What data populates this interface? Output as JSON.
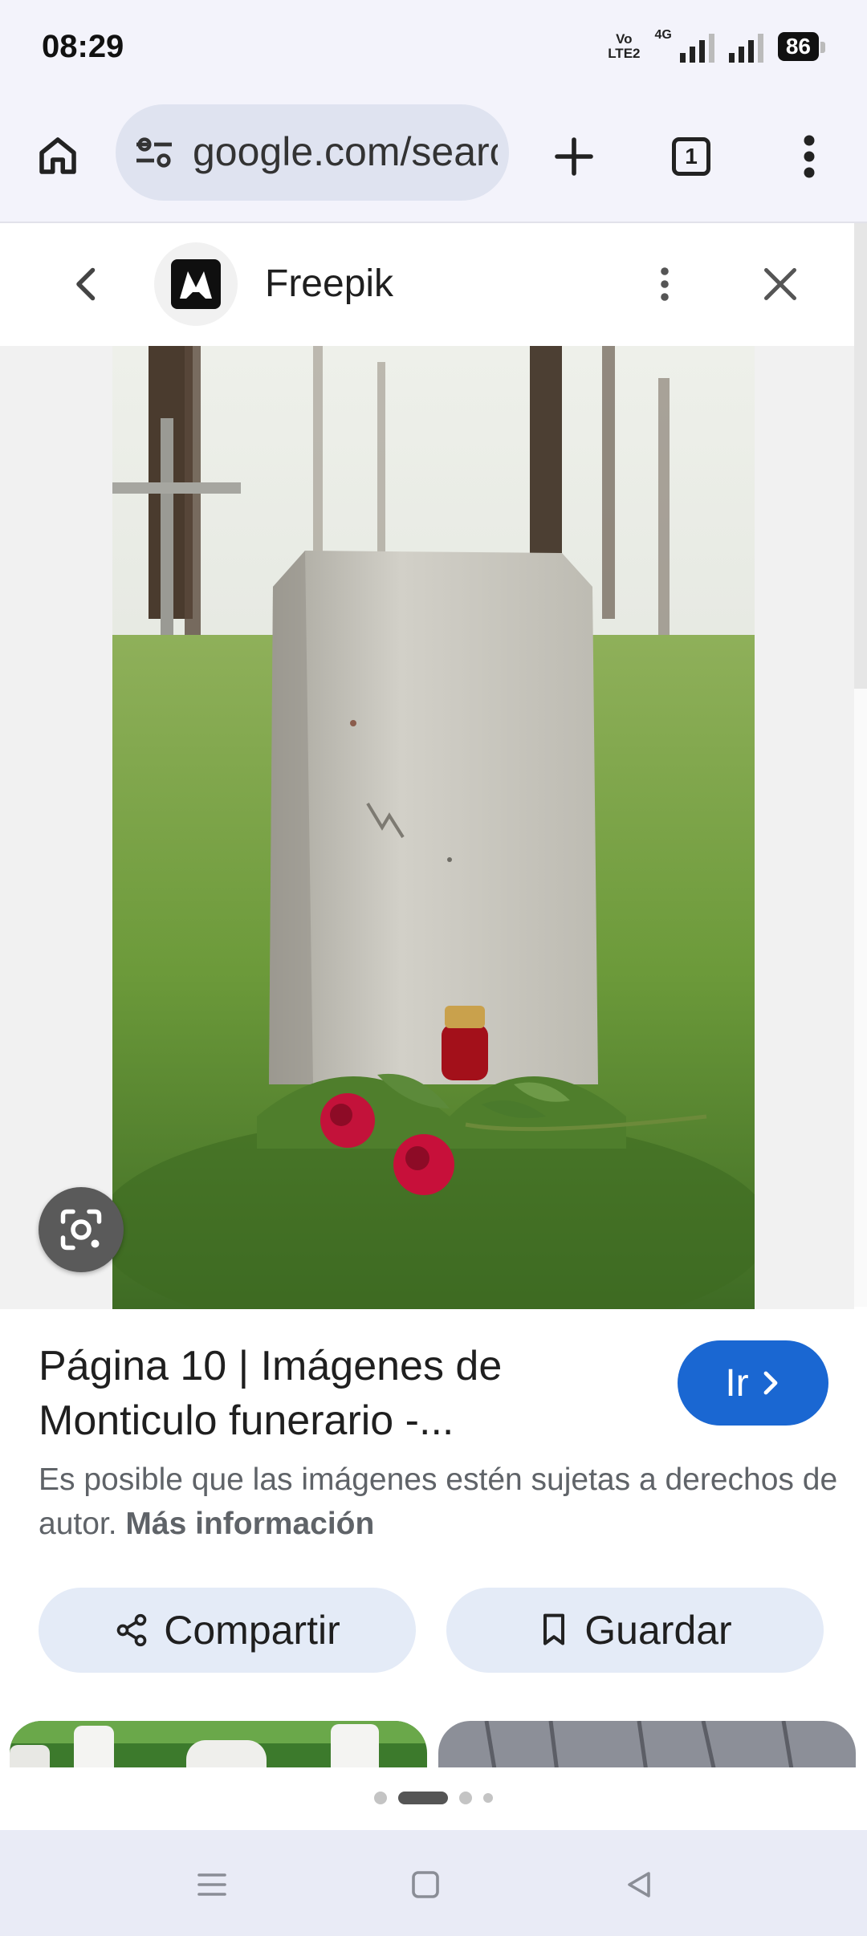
{
  "status_bar": {
    "time": "08:29",
    "volte_label": "Vo LTE2",
    "network_label": "4G",
    "battery": "86"
  },
  "browser": {
    "url": "google.com/search",
    "tab_count": "1"
  },
  "site": {
    "name": "Freepik"
  },
  "result": {
    "title": "Página 10 | Imágenes de Monticulo funerario -...",
    "go_label": "Ir",
    "copyright_text": "Es posible que las imágenes estén sujetas a derechos de autor.",
    "more_info_label": "Más información",
    "share_label": "Compartir",
    "save_label": "Guardar"
  },
  "carousel": {
    "dot_count": 4,
    "active_index": 1
  },
  "icons": {
    "home": "home-icon",
    "site_settings": "tune-icon",
    "new_tab": "plus-icon",
    "tabs": "tab-switcher-icon",
    "menu": "more-vertical-icon",
    "back": "chevron-left-icon",
    "close": "close-icon",
    "lens": "lens-icon",
    "share": "share-icon",
    "bookmark": "bookmark-icon"
  }
}
